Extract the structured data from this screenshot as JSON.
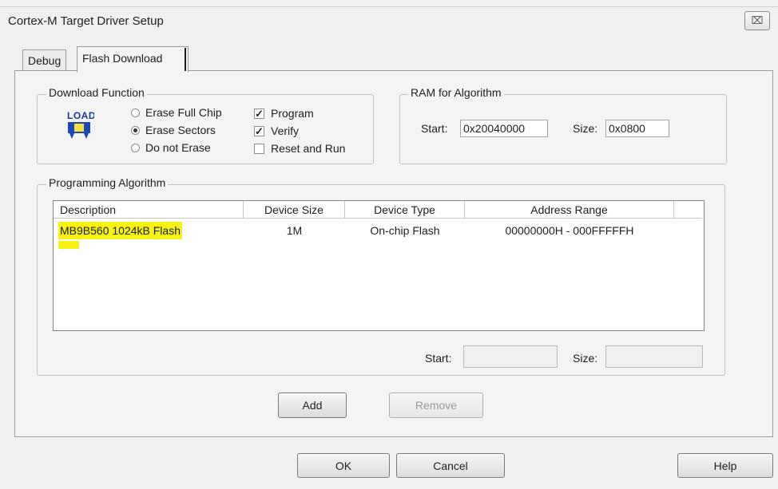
{
  "window": {
    "title": "Cortex-M Target Driver Setup",
    "close_glyph": "⌧"
  },
  "tabs": [
    {
      "label": "Debug",
      "active": false
    },
    {
      "label": "Flash Download",
      "active": true
    }
  ],
  "download_function": {
    "label": "Download Function",
    "icon_text": "LOAD",
    "radios": [
      {
        "label": "Erase Full Chip",
        "selected": false
      },
      {
        "label": "Erase Sectors",
        "selected": true
      },
      {
        "label": "Do not Erase",
        "selected": false
      }
    ],
    "checkboxes": [
      {
        "label": "Program",
        "checked": true
      },
      {
        "label": "Verify",
        "checked": true
      },
      {
        "label": "Reset and Run",
        "checked": false
      }
    ]
  },
  "ram_for_algorithm": {
    "label": "RAM for Algorithm",
    "start_label": "Start:",
    "start_value": "0x20040000",
    "size_label": "Size:",
    "size_value": "0x0800"
  },
  "programming_algorithm": {
    "label": "Programming Algorithm",
    "columns": [
      "Description",
      "Device Size",
      "Device Type",
      "Address Range"
    ],
    "rows": [
      {
        "description": "MB9B560 1024kB Flash",
        "device_size": "1M",
        "device_type": "On-chip Flash",
        "address_range": "00000000H - 000FFFFFH"
      }
    ],
    "start_label": "Start:",
    "start_value": "",
    "size_label": "Size:",
    "size_value": "",
    "add_label": "Add",
    "remove_label": "Remove"
  },
  "footer": {
    "ok_label": "OK",
    "cancel_label": "Cancel",
    "help_label": "Help"
  },
  "colors": {
    "highlight": "#f6f214"
  }
}
